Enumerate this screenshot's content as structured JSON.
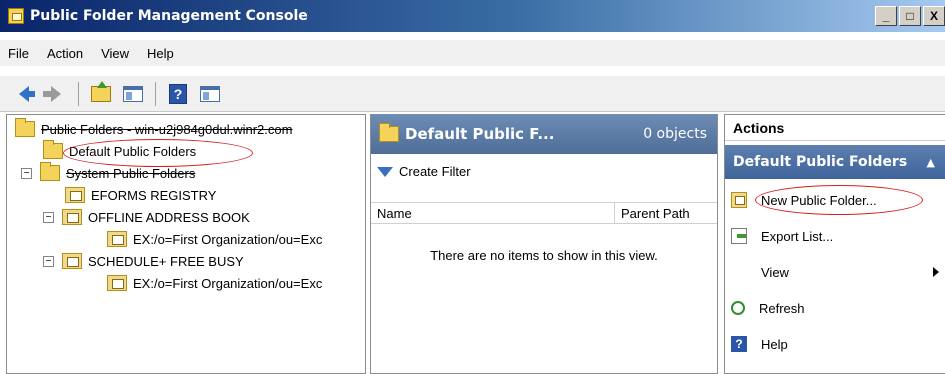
{
  "window": {
    "title": "Public Folder Management Console",
    "controls": [
      "_",
      "□",
      "X"
    ]
  },
  "menu": [
    {
      "label": "File"
    },
    {
      "label": "Action"
    },
    {
      "label": "View"
    },
    {
      "label": "Help"
    }
  ],
  "toolbar": {
    "icons": [
      "back-arrow-icon",
      "forward-arrow-icon",
      "up-folder-icon",
      "show-hide-tree-icon",
      "help-icon",
      "show-hide-action-pane-icon"
    ]
  },
  "tree": {
    "root": "Public Folders - win-u2j984g0dul.winr2.com",
    "default": "Default Public Folders",
    "system": "System Public Folders",
    "eforms": "EFORMS REGISTRY",
    "oab": "OFFLINE ADDRESS BOOK",
    "oab_child": "EX:/o=First Organization/ou=Exc",
    "schedule": "SCHEDULE+ FREE BUSY",
    "schedule_child": "EX:/o=First Organization/ou=Exc",
    "collapse_glyph": "−"
  },
  "middle": {
    "title": "Default Public F...",
    "count": "0 objects",
    "create_filter": "Create Filter",
    "columns": [
      "Name",
      "Parent Path"
    ],
    "empty_message": "There are no items to show in this view."
  },
  "actions": {
    "header": "Actions",
    "section": "Default Public Folders",
    "section_caret": "▲",
    "items": [
      {
        "label": "New Public Folder..."
      },
      {
        "label": "Export List..."
      },
      {
        "label": "View"
      },
      {
        "label": "Refresh"
      },
      {
        "label": "Help"
      }
    ]
  },
  "colors": {
    "title_start": "#0a246a",
    "header_blue": "#4e6e98",
    "highlight_ellipse": "#d42020"
  }
}
